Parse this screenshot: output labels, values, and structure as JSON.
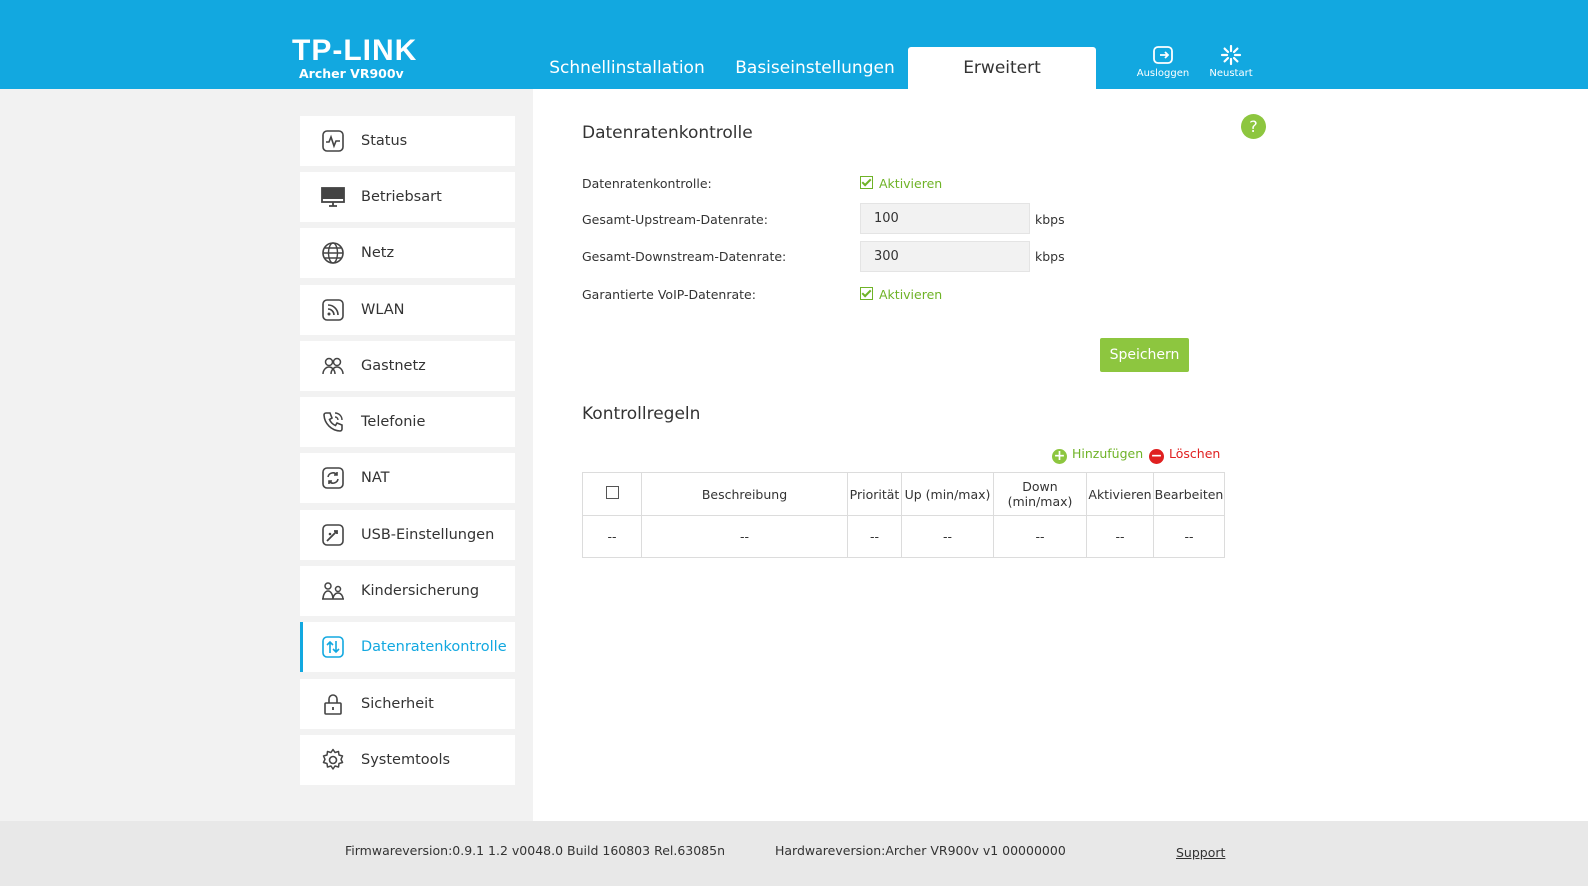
{
  "header": {
    "logo": "TP-LINK",
    "model": "Archer VR900v",
    "tabs": [
      {
        "label": "Schnellinstallation"
      },
      {
        "label": "Basiseinstellungen"
      },
      {
        "label": "Erweitert",
        "active": true
      }
    ],
    "logout_label": "Ausloggen",
    "logout_icon": "logout-icon",
    "reboot_label": "Neustart",
    "reboot_icon": "reboot-icon"
  },
  "sidebar": {
    "items": [
      {
        "label": "Status",
        "icon": "status-icon"
      },
      {
        "label": "Betriebsart",
        "icon": "monitor-icon"
      },
      {
        "label": "Netz",
        "icon": "globe-icon"
      },
      {
        "label": "WLAN",
        "icon": "wlan-icon"
      },
      {
        "label": "Gastnetz",
        "icon": "guest-icon"
      },
      {
        "label": "Telefonie",
        "icon": "phone-icon"
      },
      {
        "label": "NAT",
        "icon": "nat-icon"
      },
      {
        "label": "USB-Einstellungen",
        "icon": "usb-icon"
      },
      {
        "label": "Kindersicherung",
        "icon": "parental-icon"
      },
      {
        "label": "Datenratenkontrolle",
        "icon": "bandwidth-icon",
        "active": true
      },
      {
        "label": "Sicherheit",
        "icon": "lock-icon"
      },
      {
        "label": "Systemtools",
        "icon": "gear-icon"
      }
    ]
  },
  "main": {
    "title": "Datenratenkontrolle",
    "help_label": "?",
    "form": {
      "enable_label": "Datenratenkontrolle:",
      "enable_check": "Aktivieren",
      "enable_checked": true,
      "upstream_label": "Gesamt-Upstream-Datenrate:",
      "upstream_value": "100",
      "upstream_unit": "kbps",
      "downstream_label": "Gesamt-Downstream-Datenrate:",
      "downstream_value": "300",
      "downstream_unit": "kbps",
      "voip_label": "Garantierte VoIP-Datenrate:",
      "voip_check": "Aktivieren",
      "voip_checked": true
    },
    "save_label": "Speichern",
    "rules": {
      "title": "Kontrollregeln",
      "add_label": "Hinzufügen",
      "delete_label": "Löschen",
      "columns": [
        "Beschreibung",
        "Priorität",
        "Up (min/max)",
        "Down (min/max)",
        "Aktivieren",
        "Bearbeiten"
      ],
      "rows": [
        [
          "--",
          "--",
          "--",
          "--",
          "--",
          "--",
          "--"
        ]
      ]
    },
    "colors": {
      "accent": "#12a8e0",
      "green": "#8dc63f",
      "red": "#e02020"
    }
  },
  "footer": {
    "firmware": "Firmwareversion:0.9.1 1.2 v0048.0 Build 160803 Rel.63085n",
    "hardware": "Hardwareversion:Archer VR900v v1 00000000",
    "support": "Support"
  }
}
